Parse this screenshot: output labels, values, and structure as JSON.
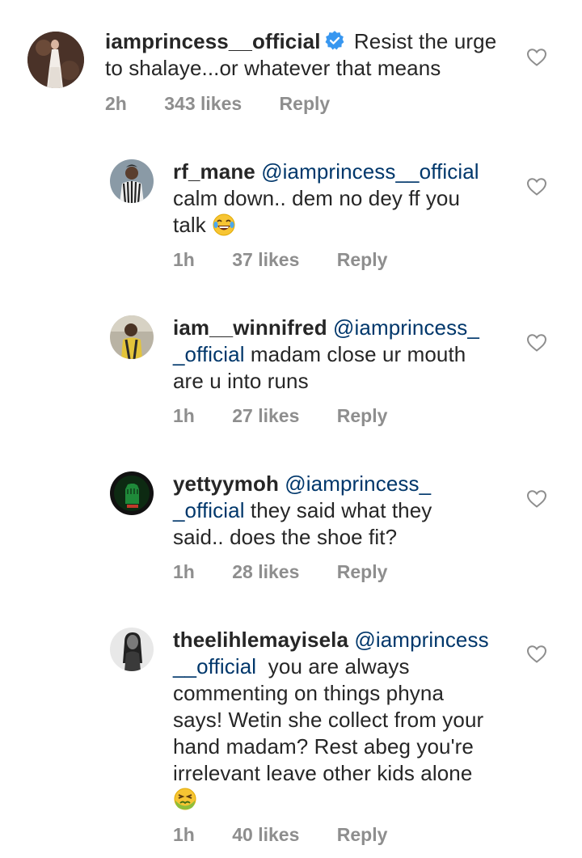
{
  "comments": [
    {
      "username": "iamprincess__official",
      "verified": true,
      "mention": "",
      "text_lines": [
        "Resist the urge",
        "to shalaye...or whatever that means"
      ],
      "time": "2h",
      "likes": "343 likes",
      "reply": "Reply",
      "avatar": "avatar-woman-white-dress"
    },
    {
      "username": "rf_mane",
      "mention": "@iamprincess__official",
      "text_lines": [
        "calm down.. dem no dey ff you",
        "talk"
      ],
      "emoji": "face-with-tears-of-joy",
      "time": "1h",
      "likes": "37 likes",
      "reply": "Reply",
      "avatar": "avatar-man-striped-shirt"
    },
    {
      "username": "iam__winnifred",
      "mention_part1": "@iamprincess_",
      "mention_part2": "_official",
      "text_after_mention": " madam close ur mouth",
      "text_line3": "are u into runs",
      "time": "1h",
      "likes": "27 likes",
      "reply": "Reply",
      "avatar": "avatar-person-yellow"
    },
    {
      "username": "yettyymoh",
      "mention_part1": "@iamprincess_",
      "mention_part2": "_official",
      "text_after_mention": " they said what they",
      "text_line3": "said.. does the shoe fit?",
      "time": "1h",
      "likes": "28 likes",
      "reply": "Reply",
      "avatar": "avatar-green-fist"
    },
    {
      "username": "theelihlemayisela",
      "mention_part1": "@iamprincess",
      "mention_part2": "__official",
      "text_after_mention": "  you are always",
      "text_lines_more": [
        "commenting on things phyna",
        "says! Wetin she collect from your",
        "hand madam? Rest abeg you're",
        "irrelevant leave other kids alone"
      ],
      "emoji": "nauseated-face",
      "time": "1h",
      "likes": "40 likes",
      "reply": "Reply",
      "avatar": "avatar-woman-bw"
    }
  ],
  "colors": {
    "text": "#262626",
    "mention": "#00376b",
    "meta": "#8e8e8e",
    "verified": "#3897f0"
  }
}
